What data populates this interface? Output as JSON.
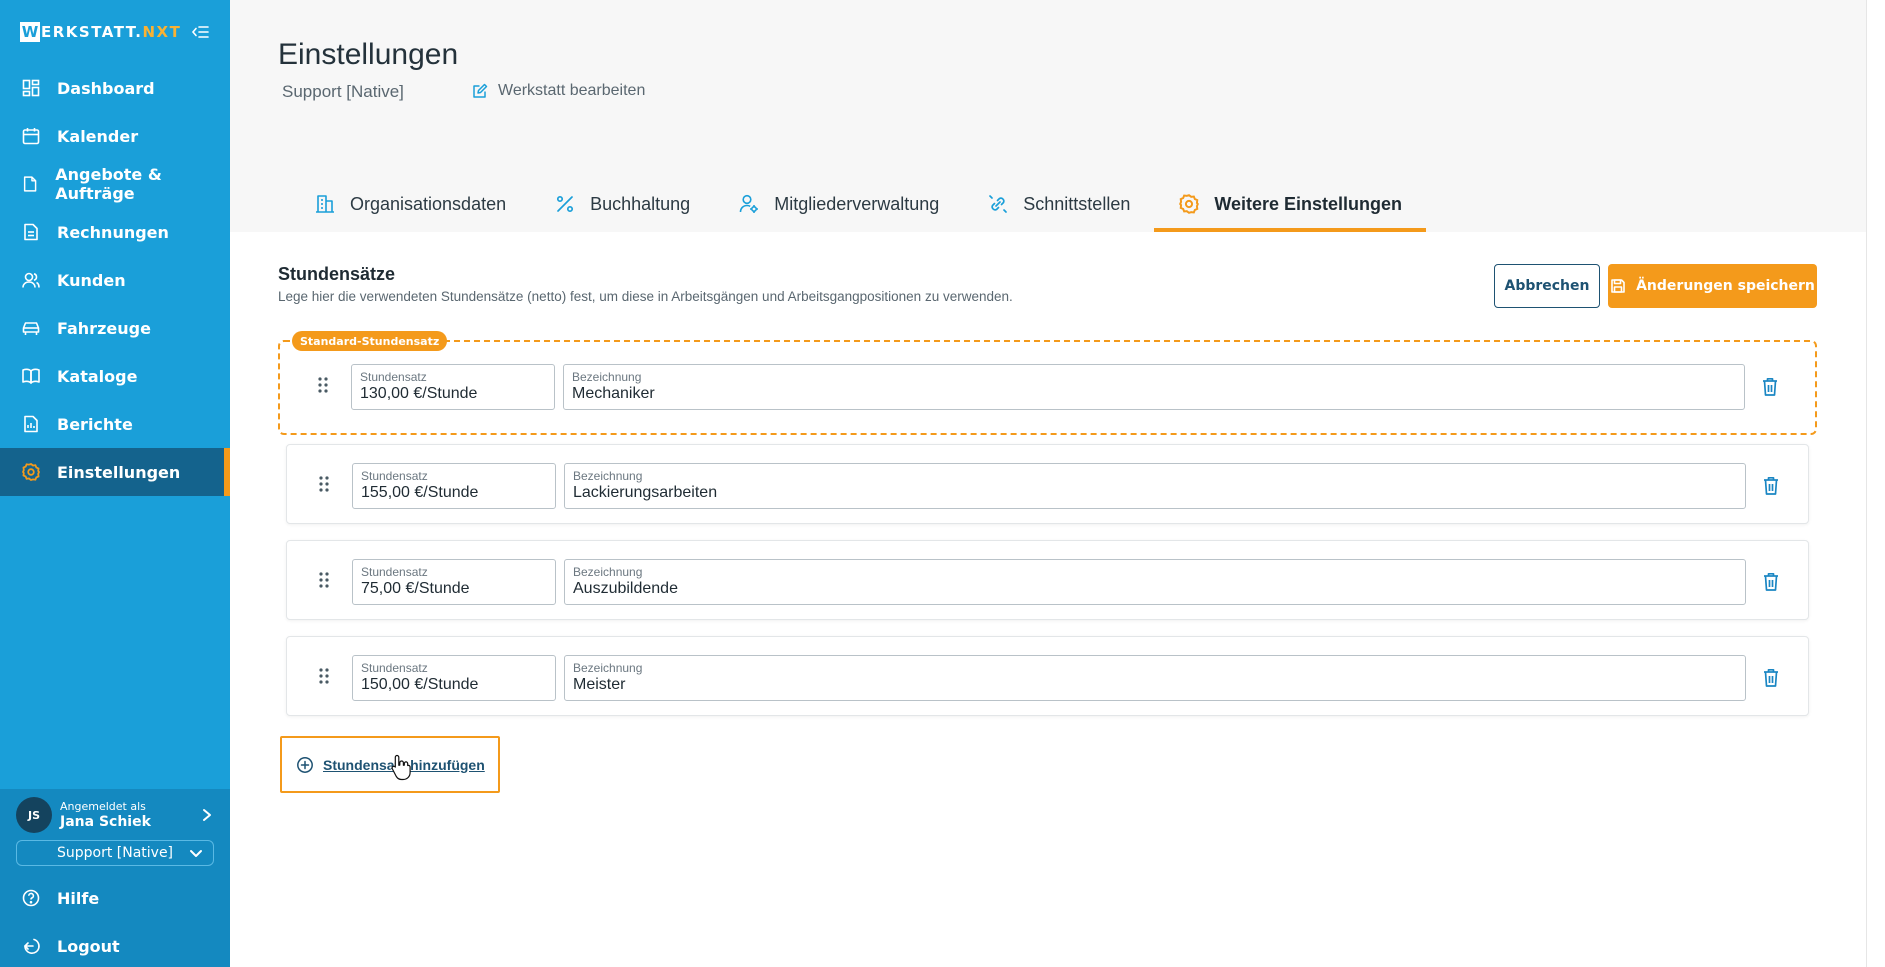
{
  "brand": {
    "logo_letter": "W",
    "logo_main": "ERKSTATT.",
    "logo_accent": "NXT",
    "accent_color": "#f49a1b",
    "primary_color": "#1a9fd9"
  },
  "sidebar": {
    "items": [
      {
        "label": "Dashboard",
        "icon": "dashboard-icon"
      },
      {
        "label": "Kalender",
        "icon": "calendar-icon"
      },
      {
        "label": "Angebote & Aufträge",
        "icon": "document-icon"
      },
      {
        "label": "Rechnungen",
        "icon": "invoice-icon"
      },
      {
        "label": "Kunden",
        "icon": "users-icon"
      },
      {
        "label": "Fahrzeuge",
        "icon": "car-icon"
      },
      {
        "label": "Kataloge",
        "icon": "book-icon"
      },
      {
        "label": "Berichte",
        "icon": "report-icon"
      },
      {
        "label": "Einstellungen",
        "icon": "gear-icon",
        "active": true
      }
    ],
    "user": {
      "logged_in_as": "Angemeldet als",
      "name": "Jana Schiek",
      "initials": "JS"
    },
    "workshop_select": "Support [Native]",
    "bottom": [
      {
        "label": "Hilfe",
        "icon": "help-icon"
      },
      {
        "label": "Logout",
        "icon": "logout-icon"
      }
    ]
  },
  "header": {
    "title": "Einstellungen",
    "subtitle": "Support [Native]",
    "edit_link": "Werkstatt bearbeiten",
    "tabs": [
      {
        "label": "Organisationsdaten",
        "icon": "building-icon"
      },
      {
        "label": "Buchhaltung",
        "icon": "percent-icon"
      },
      {
        "label": "Mitgliederverwaltung",
        "icon": "user-settings-icon"
      },
      {
        "label": "Schnittstellen",
        "icon": "link-icon"
      },
      {
        "label": "Weitere Einstellungen",
        "icon": "gear-icon",
        "active": true
      }
    ]
  },
  "section": {
    "title": "Stundensätze",
    "description": "Lege hier die verwendeten Stundensätze (netto) fest, um diese in Arbeitsgängen und Arbeitsgangpositionen zu verwenden.",
    "cancel_label": "Abbrechen",
    "save_label": "Änderungen speichern",
    "default_badge": "Standard-Stundensatz",
    "rate_label": "Stundensatz",
    "name_label": "Bezeichnung",
    "rates": [
      {
        "rate": "130,00 €/Stunde",
        "name": "Mechaniker",
        "default": true
      },
      {
        "rate": "155,00 €/Stunde",
        "name": "Lackierungsarbeiten"
      },
      {
        "rate": "75,00 €/Stunde",
        "name": "Auszubildende"
      },
      {
        "rate": "150,00 €/Stunde",
        "name": "Meister"
      }
    ],
    "add_label": "Stundensatz hinzufügen"
  }
}
